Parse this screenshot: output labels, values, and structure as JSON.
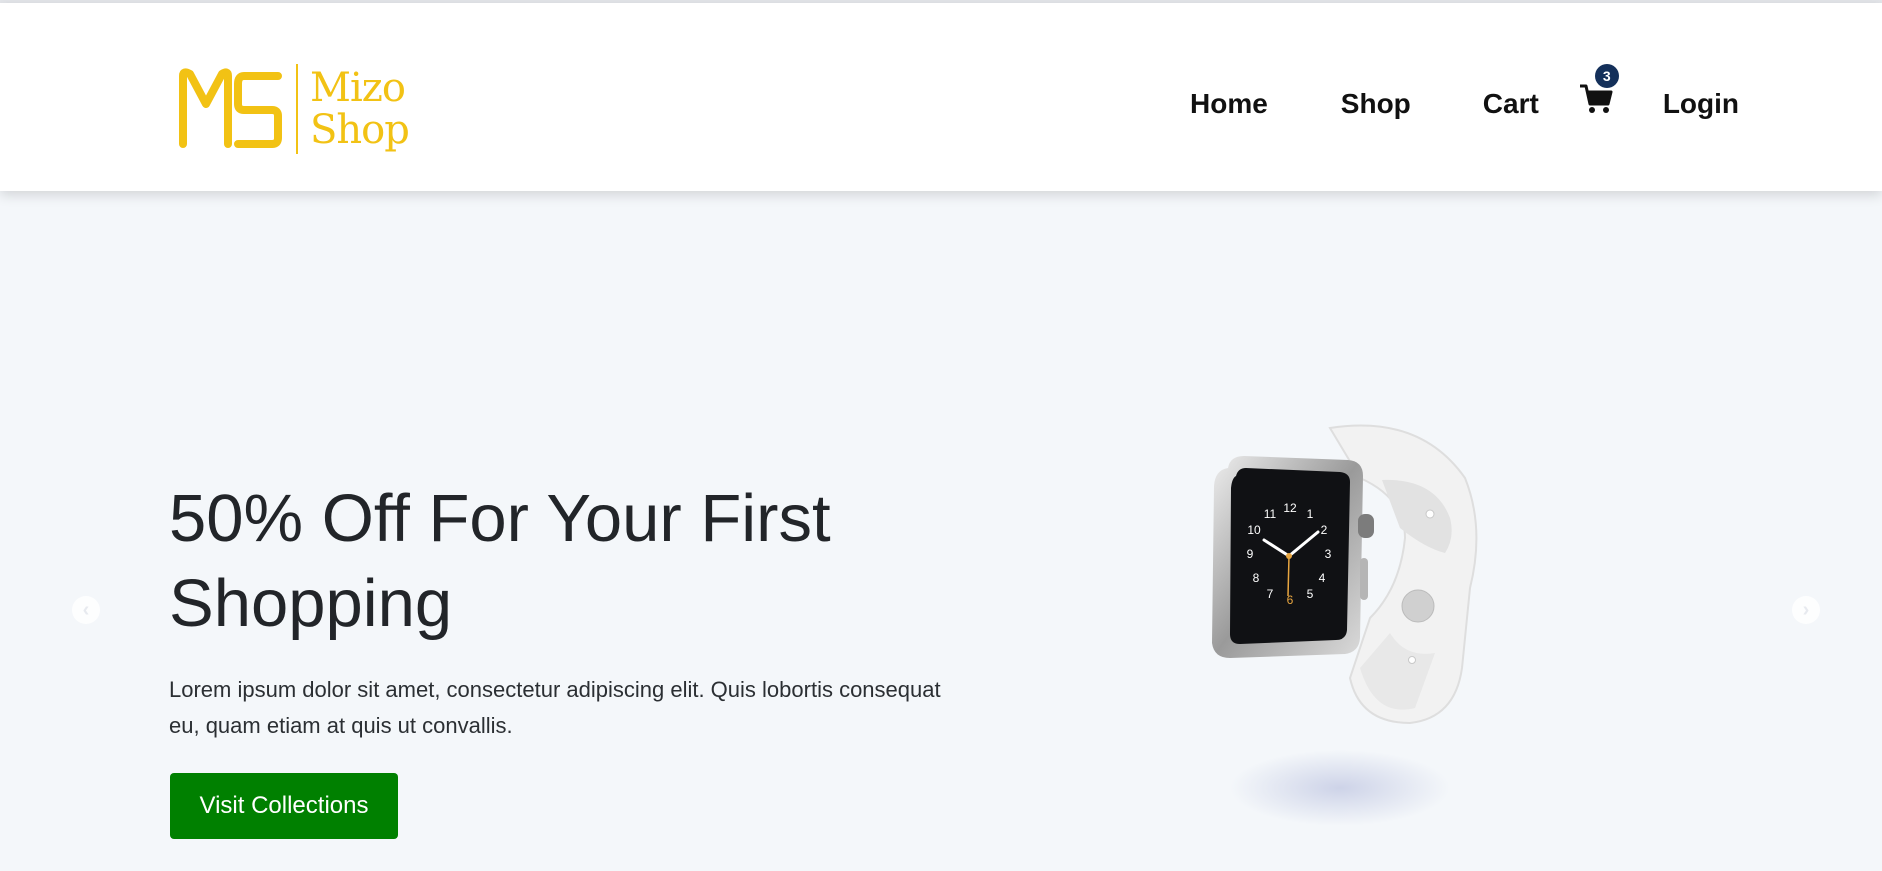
{
  "brand": {
    "mark": "MS",
    "name_line1": "Mizo",
    "name_line2": "Shop",
    "color": "#f2c214"
  },
  "nav": {
    "items": [
      {
        "label": "Home"
      },
      {
        "label": "Shop"
      },
      {
        "label": "Cart"
      },
      {
        "label": "Login"
      }
    ],
    "cart_count": "3",
    "cart_icon": "shopping-cart-icon",
    "badge_color": "#14305a"
  },
  "hero": {
    "title": "50% Off For Your First Shopping",
    "description": "Lorem ipsum dolor sit amet, consectetur adipiscing elit. Quis lobortis consequat eu, quam etiam at quis ut convallis.",
    "button_label": "Visit Collections",
    "button_color": "#008000",
    "image": "smartwatch-image"
  },
  "carousel": {
    "prev_icon": "chevron-left-icon",
    "next_icon": "chevron-right-icon"
  }
}
